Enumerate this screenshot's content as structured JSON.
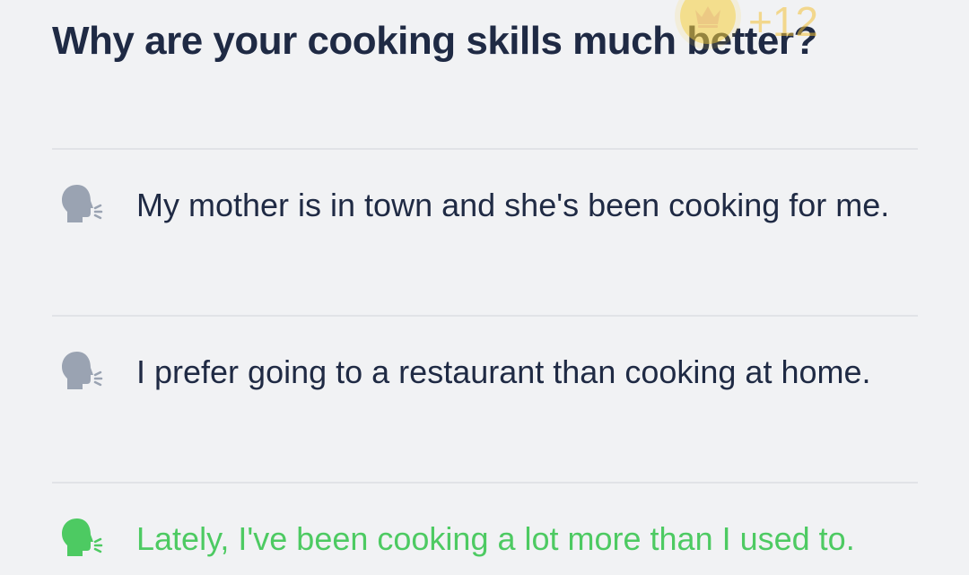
{
  "question": {
    "text": "Why are your cooking skills much better?"
  },
  "reward": {
    "icon": "crown-coin-icon",
    "amount": "+12",
    "color": "#f6cf3a"
  },
  "options": [
    {
      "text": "My mother is in town and she's been cooking for me.",
      "icon": "speaking-head-icon",
      "state": "neutral",
      "icon_color": "#9aa3b2"
    },
    {
      "text": "I prefer going to a restaurant than cooking at home.",
      "icon": "speaking-head-icon",
      "state": "neutral",
      "icon_color": "#9aa3b2"
    },
    {
      "text": "Lately, I've been cooking a lot more than I used to.",
      "icon": "speaking-head-icon",
      "state": "correct",
      "icon_color": "#4dca62"
    }
  ],
  "colors": {
    "background": "#f1f2f4",
    "text": "#1f2a44",
    "correct": "#4dca62",
    "divider": "#e1e3e7"
  }
}
